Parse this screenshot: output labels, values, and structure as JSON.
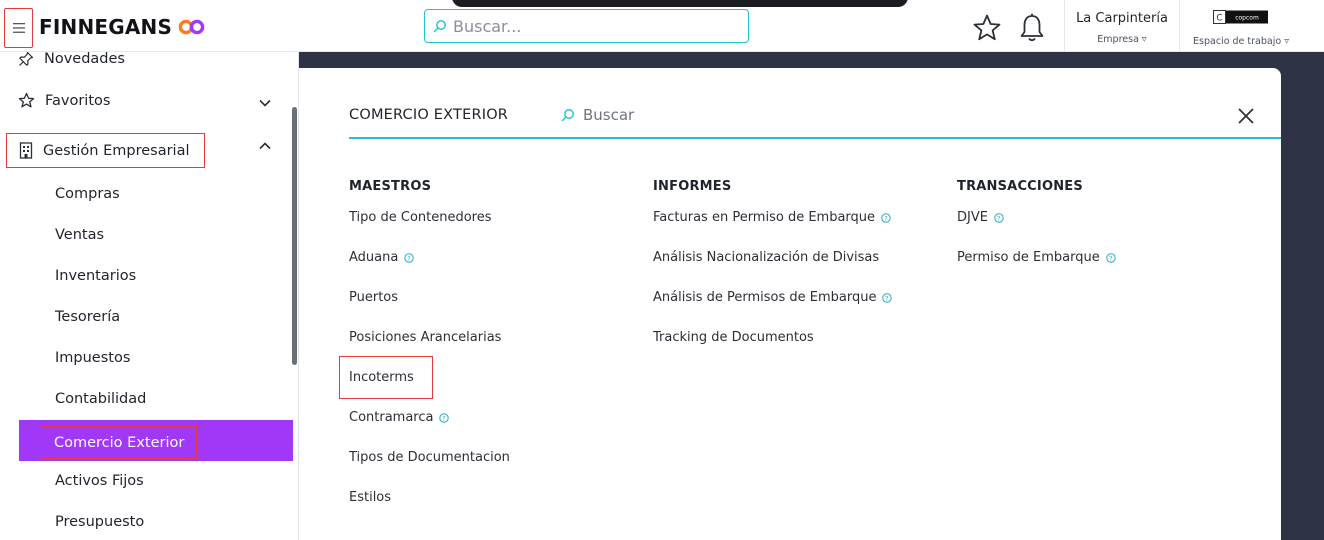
{
  "header": {
    "logo_text": "FINNEGANS",
    "search_placeholder": "Buscar...",
    "company_name": "La Carpintería",
    "company_label": "Empresa ▿",
    "workspace_label": "Espacio de trabajo ▿",
    "workspace_logo_text": "copcom"
  },
  "sidebar": {
    "top_items": [
      {
        "label": "Novedades",
        "icon": "pin-icon"
      },
      {
        "label": "Favoritos",
        "icon": "star-icon"
      }
    ],
    "section": {
      "label": "Gestión Empresarial",
      "icon": "building-icon"
    },
    "sub_items": [
      "Compras",
      "Ventas",
      "Inventarios",
      "Tesorería",
      "Impuestos",
      "Contabilidad",
      "Comercio Exterior",
      "Activos Fijos",
      "Presupuesto"
    ],
    "active_item": "Comercio Exterior"
  },
  "panel": {
    "title": "COMERCIO EXTERIOR",
    "search_placeholder": "Buscar",
    "columns": [
      {
        "heading": "MAESTROS",
        "links": [
          {
            "label": "Tipo de Contenedores",
            "help": false
          },
          {
            "label": "Aduana",
            "help": true
          },
          {
            "label": "Puertos",
            "help": false
          },
          {
            "label": "Posiciones Arancelarias",
            "help": false
          },
          {
            "label": "Incoterms",
            "help": false
          },
          {
            "label": "Contramarca",
            "help": true
          },
          {
            "label": "Tipos de Documentacion",
            "help": false
          },
          {
            "label": "Estilos",
            "help": false
          }
        ]
      },
      {
        "heading": "INFORMES",
        "links": [
          {
            "label": "Facturas en Permiso de Embarque",
            "help": true
          },
          {
            "label": "Análisis Nacionalización de Divisas",
            "help": false
          },
          {
            "label": "Análisis de Permisos de Embarque",
            "help": true
          },
          {
            "label": "Tracking de Documentos",
            "help": false
          }
        ]
      },
      {
        "heading": "TRANSACCIONES",
        "links": [
          {
            "label": "DJVE",
            "help": true
          },
          {
            "label": "Permiso de Embarque",
            "help": true
          }
        ]
      }
    ]
  },
  "colors": {
    "accent_purple": "#a238f7",
    "accent_teal": "#27c2cf",
    "highlight_red": "#e23b3b",
    "main_bg": "#2e3446"
  }
}
